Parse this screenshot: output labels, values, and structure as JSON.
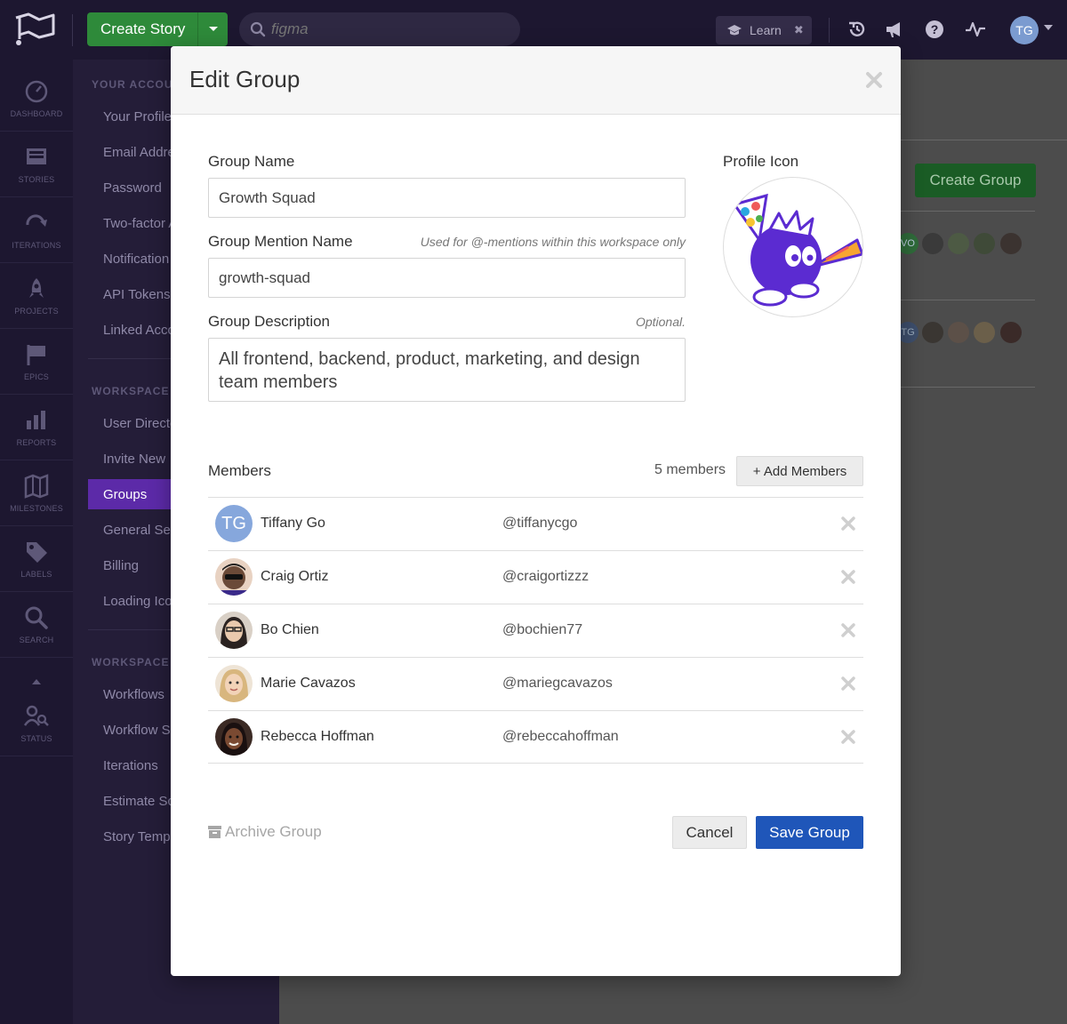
{
  "topbar": {
    "create_story_label": "Create Story",
    "search_placeholder": "figma",
    "learn_label": "Learn",
    "user_initials": "TG"
  },
  "rail": {
    "items": [
      {
        "label": "DASHBOARD",
        "icon": "dashboard-icon"
      },
      {
        "label": "STORIES",
        "icon": "stories-icon"
      },
      {
        "label": "ITERATIONS",
        "icon": "iterations-icon"
      },
      {
        "label": "PROJECTS",
        "icon": "projects-icon"
      },
      {
        "label": "EPICS",
        "icon": "epics-icon"
      },
      {
        "label": "REPORTS",
        "icon": "reports-icon"
      },
      {
        "label": "MILESTONES",
        "icon": "milestones-icon"
      },
      {
        "label": "LABELS",
        "icon": "labels-icon"
      },
      {
        "label": "SEARCH",
        "icon": "search-icon"
      },
      {
        "label": "STATUS",
        "icon": "status-icon"
      }
    ]
  },
  "settings": {
    "section_account": "YOUR ACCOUN",
    "account_items": [
      "Your Profile",
      "Email Addre",
      "Password",
      "Two-factor A",
      "Notification",
      "API Tokens",
      "Linked Acco"
    ],
    "section_workspace": "WORKSPACE S",
    "workspace_items": [
      "User Directo",
      "Invite New",
      "Groups",
      "General Set",
      "Billing",
      "Loading Ico"
    ],
    "section_features": "WORKSPACE F",
    "feature_items": [
      "Workflows",
      "Workflow S",
      "Iterations",
      "Estimate Sc",
      "Story Temp"
    ]
  },
  "main": {
    "create_group_label": "Create Group",
    "row1_badge": "VO",
    "row2_badge": "TG"
  },
  "modal": {
    "title": "Edit Group",
    "group_name_label": "Group Name",
    "group_name_value": "Growth Squad",
    "mention_label": "Group Mention Name",
    "mention_hint": "Used for @-mentions within this workspace only",
    "mention_value": "growth-squad",
    "description_label": "Group Description",
    "description_hint": "Optional.",
    "description_value": "All frontend, backend, product, marketing, and design team members",
    "profile_icon_label": "Profile Icon",
    "members_label": "Members",
    "members_count": "5 members",
    "add_members_label": "+ Add Members",
    "members": [
      {
        "name": "Tiffany Go",
        "handle": "@tiffanycgo",
        "initials": "TG"
      },
      {
        "name": "Craig Ortiz",
        "handle": "@craigortizzz"
      },
      {
        "name": "Bo Chien",
        "handle": "@bochien77"
      },
      {
        "name": "Marie Cavazos",
        "handle": "@mariegcavazos"
      },
      {
        "name": "Rebecca Hoffman",
        "handle": "@rebeccahoffman"
      }
    ],
    "archive_label": "Archive Group",
    "cancel_label": "Cancel",
    "save_label": "Save Group"
  },
  "colors": {
    "topbar_bg": "#1d1730",
    "create_story_green": "#2e8a3a",
    "groups_active_purple": "#5c2aa8",
    "save_blue": "#1f56b9"
  }
}
